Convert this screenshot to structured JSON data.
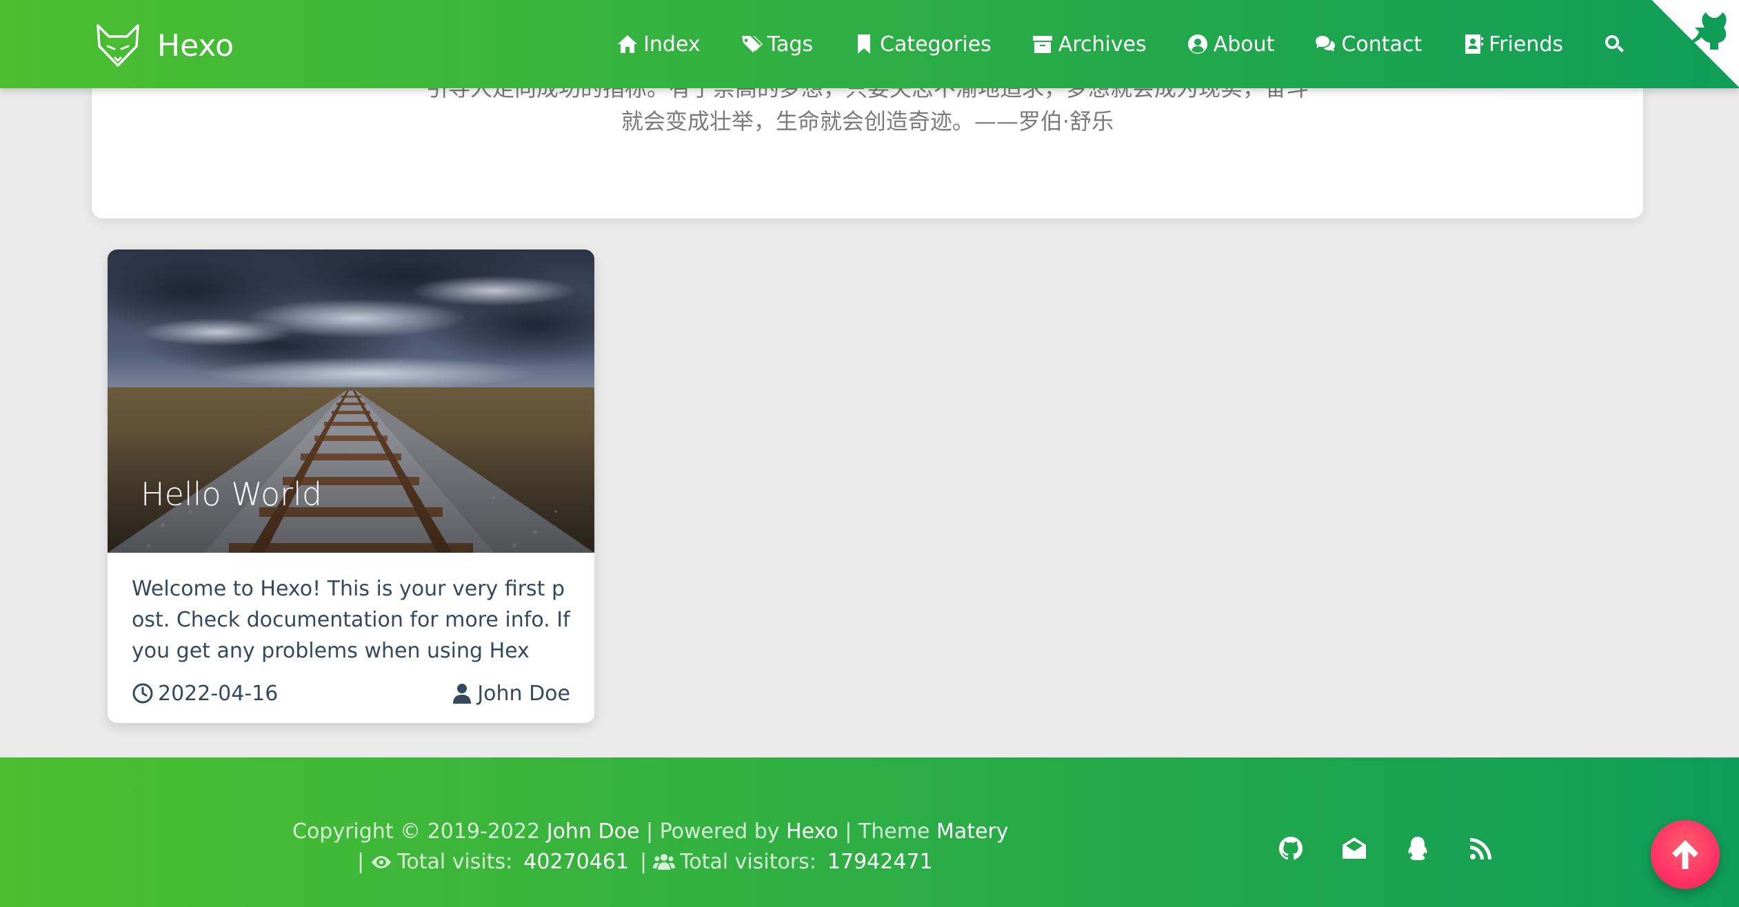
{
  "header": {
    "brand": "Hexo",
    "nav": [
      {
        "label": "Index",
        "icon": "home-icon"
      },
      {
        "label": "Tags",
        "icon": "tags-icon"
      },
      {
        "label": "Categories",
        "icon": "bookmark-icon"
      },
      {
        "label": "Archives",
        "icon": "archive-icon"
      },
      {
        "label": "About",
        "icon": "user-circle-icon"
      },
      {
        "label": "Contact",
        "icon": "comments-icon"
      },
      {
        "label": "Friends",
        "icon": "address-book-icon"
      }
    ],
    "search_icon": "search-icon",
    "corner_icon": "github-corner-icon"
  },
  "intro": {
    "quote_line1": "引导人走向成功的指标。有了崇高的梦想，只要矢志不渝地追求，梦想就会成为现实，奋斗",
    "quote_line2": "就会变成壮举，生命就会创造奇迹。——罗伯·舒乐"
  },
  "post": {
    "title": "Hello World",
    "excerpt": "Welcome to Hexo! This is your very first post. Check documentation for more info. If you get any problems when using Hex",
    "date": "2022-04-16",
    "author": "John Doe"
  },
  "footer": {
    "copyright_prefix": "Copyright © 2019-2022",
    "author": "John Doe",
    "powered_by": "| Powered by",
    "powered_name": "Hexo",
    "theme_prefix": "| Theme",
    "theme_name": "Matery",
    "visits_sep": "|",
    "visits_label": "Total visits:",
    "visits_value": "40270461",
    "visitors_sep": "|",
    "visitors_label": "Total visitors:",
    "visitors_value": "17942471",
    "social": [
      "github-icon",
      "envelope-icon",
      "qq-icon",
      "rss-icon"
    ]
  },
  "colors": {
    "header_gradient_start": "#4cbf30",
    "header_gradient_end": "#0f9d58",
    "back_to_top": "#ff3366",
    "text_dark": "#34495e"
  }
}
